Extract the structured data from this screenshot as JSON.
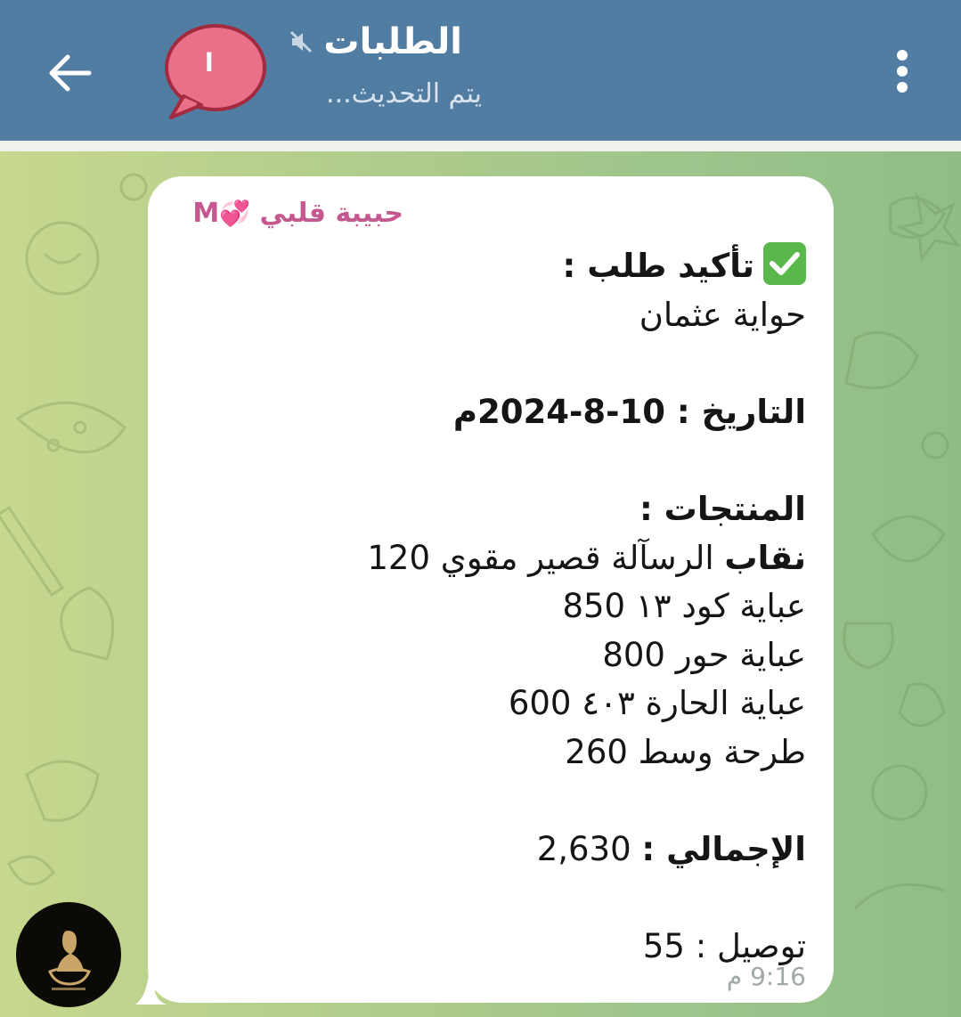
{
  "header": {
    "title": "الطلبات",
    "subtitle": "يتم التحديث...",
    "avatar_glyph": "ا",
    "colors": {
      "bar": "#527da3",
      "avatar": "#ea6f88"
    }
  },
  "message": {
    "sender": "حبيبة قلبي",
    "sender_suffix": "M",
    "sender_emoji": "💞",
    "heading": "تأكيد طلب :",
    "seller": "حواية عثمان",
    "date_label": "التاريخ :",
    "date_value": "10-8-2024م",
    "products_label": "المنتجات :",
    "products": [
      {
        "name_bold": "نقاب",
        "name": "الرسآلة قصير مقوي",
        "price": "120"
      },
      {
        "name_bold": "",
        "name": "عباية كود ١٣",
        "price": "850"
      },
      {
        "name_bold": "",
        "name": "عباية حور",
        "price": "800"
      },
      {
        "name_bold": "",
        "name": "عباية الحارة ٤٠٣",
        "price": "600"
      },
      {
        "name_bold": "",
        "name": "طرحة وسط",
        "price": "260"
      }
    ],
    "total_label": "الإجمالي :",
    "total_value": "2,630",
    "delivery_label": "توصيل :",
    "delivery_value": "55",
    "time": "9:16 م"
  },
  "icons": {
    "back": "arrow-left-icon",
    "mute": "muted-speaker-icon",
    "menu": "more-vertical-icon",
    "check": "check-mark-emoji-icon"
  }
}
